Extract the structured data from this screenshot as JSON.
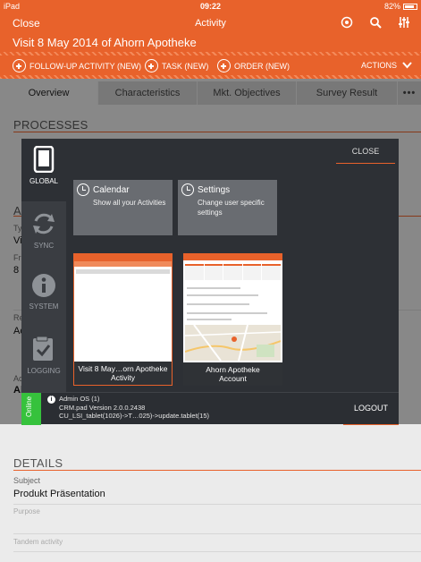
{
  "status": {
    "device": "iPad",
    "time": "09:22",
    "battery": "82%"
  },
  "nav": {
    "close_label": "Close",
    "title": "Activity"
  },
  "visit": {
    "title": "Visit 8 May 2014 of  Ahorn Apotheke"
  },
  "actions": {
    "items": [
      "FOLLOW-UP ACTIVITY (NEW)",
      "TASK (NEW)",
      "ORDER (NEW)"
    ],
    "menu_label": "ACTIONS"
  },
  "tabs": [
    "Overview",
    "Characteristics",
    "Mkt. Objectives",
    "Survey Result",
    "•••"
  ],
  "processes": {
    "title": "PROCESSES"
  },
  "background": {
    "activity_section": "AC",
    "type_label": "Ty",
    "type_value": "Vi",
    "from_label": "Fr",
    "from_value": "8",
    "responsible_label": "Re",
    "responsible_value": "Ac",
    "account_label": "Ac",
    "account_value": "Al"
  },
  "details": {
    "title": "DETAILS",
    "subject_label": "Subject",
    "subject_value": "Produkt Präsentation",
    "purpose_placeholder": "Purpose",
    "tandem_placeholder": "Tandem activity"
  },
  "modal": {
    "close_label": "CLOSE",
    "sidebar": [
      {
        "label": "GLOBAL",
        "icon": "tablet-icon"
      },
      {
        "label": "SYNC",
        "icon": "sync-icon"
      },
      {
        "label": "SYSTEM",
        "icon": "info-icon"
      },
      {
        "label": "LOGGING",
        "icon": "checklist-icon"
      }
    ],
    "tiles": [
      {
        "title": "Calendar",
        "subtitle": "Show all your Activities"
      },
      {
        "title": "Settings",
        "subtitle": "Change user specific settings"
      }
    ],
    "thumbs": [
      {
        "caption_line1": "Visit 8 May…orn Apotheke",
        "caption_line2": "Activity"
      },
      {
        "caption_line1": "Ahorn Apotheke",
        "caption_line2": "Account"
      }
    ],
    "footer": {
      "online_label": "Online",
      "line1": "Admin OS (1)",
      "line2": "CRM.pad Version 2.0.0.2438",
      "line3": "CU_LSI_tablet(1026)->T…025)->update.tablet(15)",
      "logout_label": "LOGOUT"
    }
  },
  "colors": {
    "accent": "#e8622b",
    "online": "#36c23c",
    "modal_bg": "#2d3035"
  }
}
